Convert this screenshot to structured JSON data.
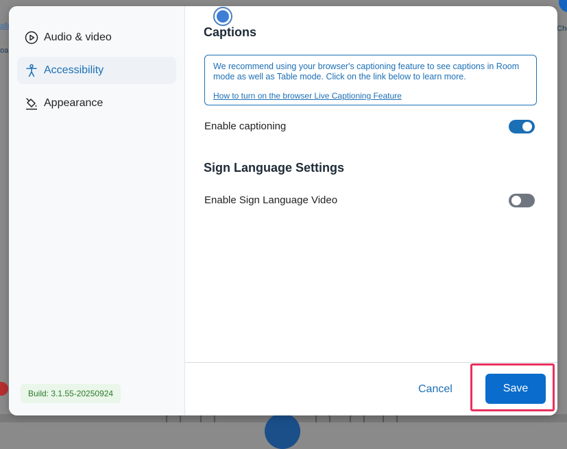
{
  "background": {
    "fragment_top_left": "alle",
    "fragment_mid_left": "oa",
    "fragment_top_right": "Che"
  },
  "sidebar": {
    "items": [
      {
        "label": "Audio & video",
        "icon": "play-circle-icon",
        "active": false
      },
      {
        "label": "Accessibility",
        "icon": "accessibility-icon",
        "active": true
      },
      {
        "label": "Appearance",
        "icon": "paint-bucket-icon",
        "active": false
      }
    ],
    "build": "Build: 3.1.55-20250924"
  },
  "content": {
    "captions": {
      "heading": "Captions",
      "info_text": "We recommend using your browser's captioning feature to see captions in Room mode as well as Table mode. Click on the link below to learn more.",
      "info_link": "How to turn on the browser Live Captioning Feature",
      "enable_label": "Enable captioning",
      "enabled": true
    },
    "sign_language": {
      "heading": "Sign Language Settings",
      "enable_label": "Enable Sign Language Video",
      "enabled": false
    }
  },
  "footer": {
    "cancel_label": "Cancel",
    "save_label": "Save"
  },
  "colors": {
    "accent": "#1b6fb5",
    "save_button": "#0a6ccc",
    "highlight": "#e8305e"
  }
}
